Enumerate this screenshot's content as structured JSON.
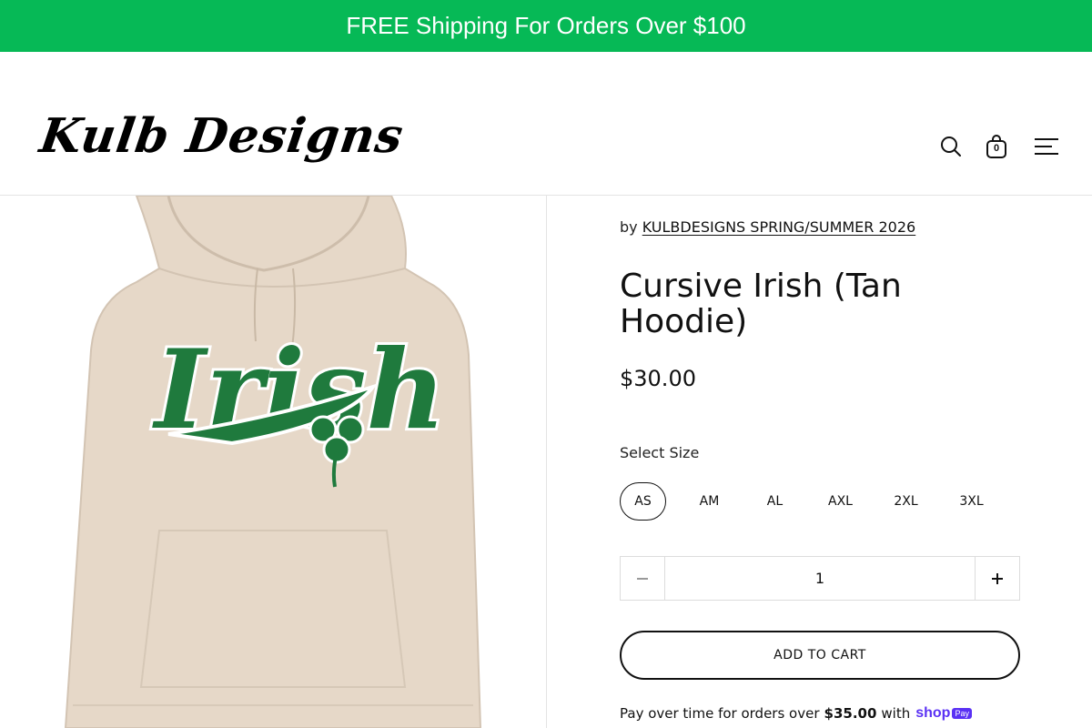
{
  "announcement": {
    "text": "FREE Shipping For Orders Over $100"
  },
  "header": {
    "logo_text": "Kulb Designs",
    "cart_count": "0",
    "icons": [
      "search-icon",
      "shopping-bag-icon",
      "menu-icon"
    ]
  },
  "product": {
    "vendor_prefix": "by",
    "vendor_name": "KULBDESIGNS SPRING/SUMMER 2026",
    "title": "Cursive Irish (Tan Hoodie)",
    "price": "$30.00",
    "image_text": "Irish",
    "size_label": "Select Size",
    "sizes": [
      "AS",
      "AM",
      "AL",
      "AXL",
      "2XL",
      "3XL"
    ],
    "selected_size": "AS",
    "quantity": "1",
    "add_to_cart_label": "ADD TO CART",
    "installments": {
      "prefix": "Pay over time for orders over",
      "amount": "$35.00",
      "suffix": "with",
      "brand": "shop",
      "badge": "Pay"
    }
  },
  "colors": {
    "announcement_bg": "#06b956",
    "hoodie": "#e6d8c8",
    "print_green": "#1f7a3d",
    "shop_purple": "#5a31f4"
  }
}
